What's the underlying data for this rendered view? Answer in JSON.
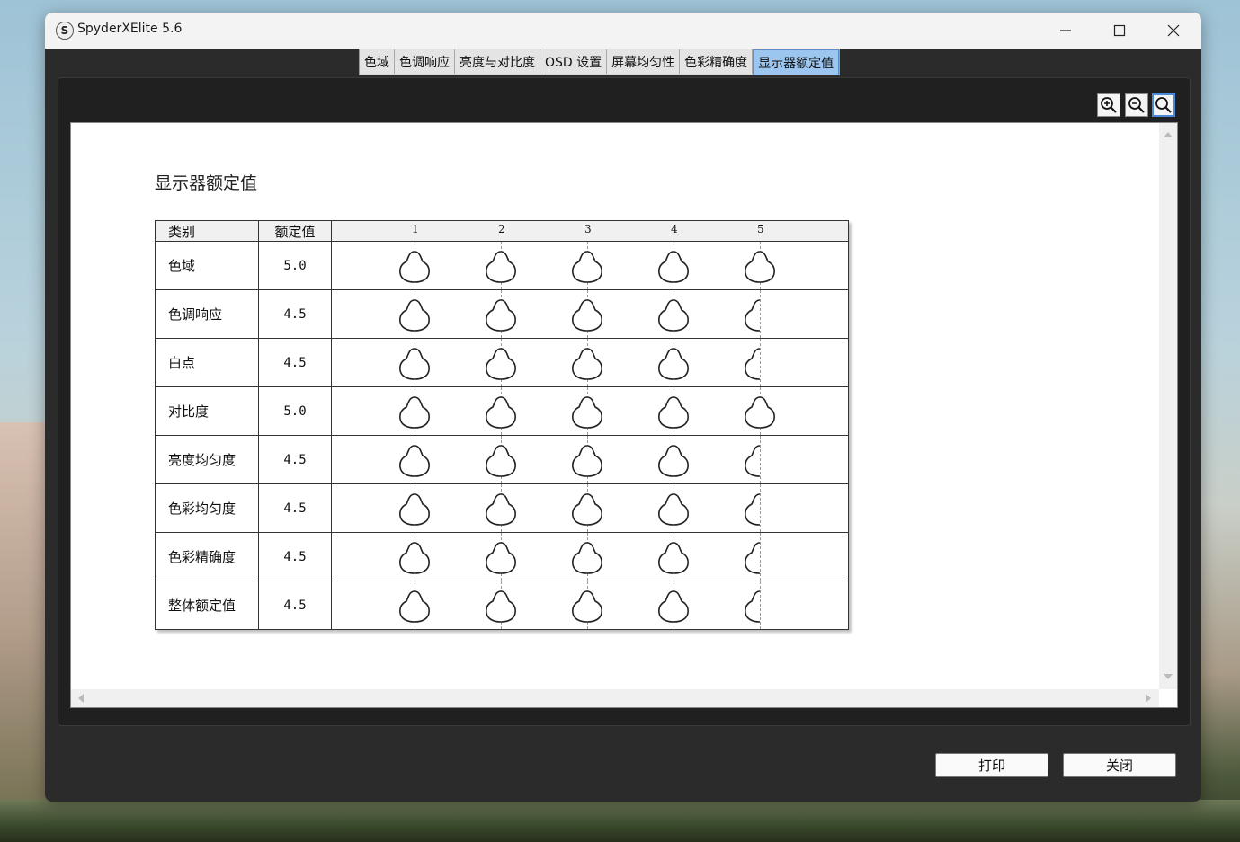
{
  "window": {
    "title": "SpyderXElite 5.6",
    "app_icon": "S"
  },
  "tabs": [
    {
      "label": "色域",
      "active": false
    },
    {
      "label": "色调响应",
      "active": false
    },
    {
      "label": "亮度与对比度",
      "active": false
    },
    {
      "label": "OSD 设置",
      "active": false
    },
    {
      "label": "屏幕均匀性",
      "active": false
    },
    {
      "label": "色彩精确度",
      "active": false
    },
    {
      "label": "显示器额定值",
      "active": true
    }
  ],
  "zoom_buttons": [
    "zoom-in-icon",
    "zoom-out-icon",
    "zoom-fit-icon"
  ],
  "report": {
    "title": "显示器额定值",
    "header": {
      "category": "类别",
      "rating": "额定值",
      "scale": [
        "1",
        "2",
        "3",
        "4",
        "5"
      ]
    },
    "rows": [
      {
        "category": "色域",
        "rating": "5.0",
        "value": 5.0
      },
      {
        "category": "色调响应",
        "rating": "4.5",
        "value": 4.5
      },
      {
        "category": "白点",
        "rating": "4.5",
        "value": 4.5
      },
      {
        "category": "对比度",
        "rating": "5.0",
        "value": 5.0
      },
      {
        "category": "亮度均匀度",
        "rating": "4.5",
        "value": 4.5
      },
      {
        "category": "色彩均匀度",
        "rating": "4.5",
        "value": 4.5
      },
      {
        "category": "色彩精确度",
        "rating": "4.5",
        "value": 4.5
      },
      {
        "category": "整体额定值",
        "rating": "4.5",
        "value": 4.5
      }
    ]
  },
  "buttons": {
    "print": "打印",
    "close": "关闭"
  },
  "colors": {
    "active_tab": "#9cc6ef",
    "window_bg": "#2b2b2b"
  }
}
